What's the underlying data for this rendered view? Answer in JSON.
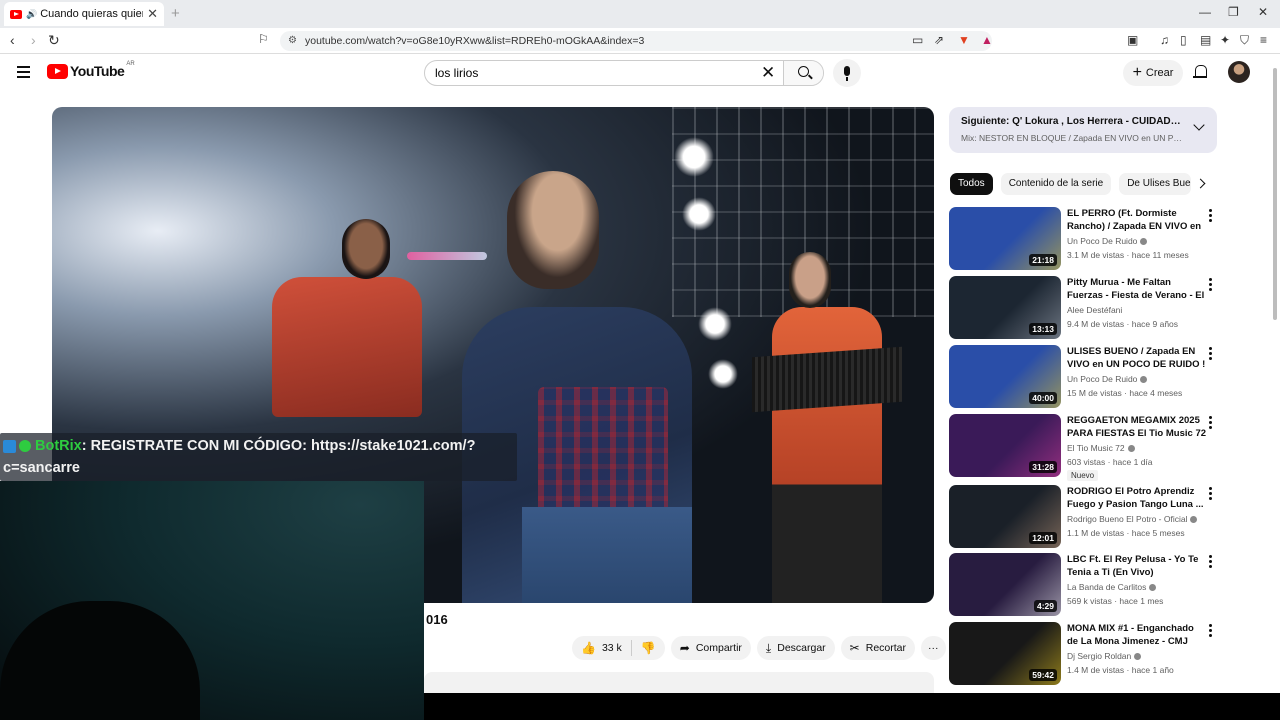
{
  "browser": {
    "tab_title": "Cuando quieras quiero/Ojalá",
    "tab_close": "✕",
    "new_tab": "+",
    "url": "youtube.com/watch?v=oG8e10yRXww&list=RDREh0-mOGkAA&index=3",
    "window_controls": [
      "—",
      "❐",
      "✕"
    ],
    "nav": [
      "‹",
      "›",
      "↻"
    ]
  },
  "header": {
    "logo_text": "YouTube",
    "country_code": "AR",
    "search_value": "los lirios",
    "create_label": "Crear"
  },
  "overlay": {
    "bot_name": "BotRix",
    "chat_line1": " : REGISTRATE CON MI CÓDIGO: https://stake1021.com/?",
    "chat_line2": "c=sancarre"
  },
  "video": {
    "title_fragment": "016",
    "like_count": "33 k",
    "share_label": "Compartir",
    "download_label": "Descargar",
    "clip_label": "Recortar",
    "more_label": "···"
  },
  "up_next": {
    "title": "Siguiente: Q' Lokura , Los Herrera - CUIDADO QUE T...",
    "mix": "Mix: NESTOR EN BLOQUE / Zapada EN VIVO en UN POCO D..."
  },
  "chips": [
    "Todos",
    "Contenido de la serie",
    "De Ulises Bueno"
  ],
  "recommendations": [
    {
      "title": "EL PERRO (Ft. Dormiste Rancho) / Zapada EN VIVO en ...",
      "channel": "Un Poco De Ruido",
      "verified": true,
      "meta": "3.1 M de vistas · hace 11 meses",
      "duration": "21:18",
      "thumb_color": "#2a4ea8",
      "accent": "#f5d21f"
    },
    {
      "title": "Pitty Murua - Me Faltan Fuerzas - Fiesta de Verano - El ...",
      "channel": "Alee Destéfani",
      "verified": false,
      "meta": "9.4 M de vistas · hace 9 años",
      "duration": "13:13",
      "thumb_color": "#1c2632",
      "accent": "#b0b8c4"
    },
    {
      "title": "ULISES BUENO / Zapada EN VIVO en UN POCO DE RUIDO !",
      "channel": "Un Poco De Ruido",
      "verified": true,
      "meta": "15 M de vistas · hace 4 meses",
      "duration": "40:00",
      "thumb_color": "#2a4ea8",
      "accent": "#f5d21f"
    },
    {
      "title": "REGGAETON MEGAMIX 2025 PARA FIESTAS El Tio Music 72",
      "channel": "El Tio Music 72",
      "verified": true,
      "meta": "603 vistas · hace 1 día",
      "duration": "31:28",
      "thumb_color": "#3a1a58",
      "accent": "#e040a0",
      "new_label": "Nuevo"
    },
    {
      "title": "RODRIGO El Potro Aprendiz Fuego y Pasion Tango Luna ...",
      "channel": "Rodrigo Bueno El Potro - Oficial",
      "verified": true,
      "meta": "1.1 M de vistas · hace 5 meses",
      "duration": "12:01",
      "thumb_color": "#1a2028",
      "accent": "#c8a080"
    },
    {
      "title": "LBC Ft. El Rey Pelusa - Yo Te Tenia a Ti (En Vivo)",
      "channel": "La Banda de Carlitos",
      "verified": true,
      "meta": "569 k vistas · hace 1 mes",
      "duration": "4:29",
      "thumb_color": "#281c40",
      "accent": "#ffffff"
    },
    {
      "title": "MONA MIX #1 - Enganchado de La Mona Jimenez - CMJ",
      "channel": "Dj Sergio Roldan",
      "verified": true,
      "meta": "1.4 M de vistas · hace 1 año",
      "duration": "59:42",
      "thumb_color": "#181818",
      "accent": "#f5d21f"
    }
  ],
  "colors": {
    "brand_red": "#ff0000",
    "bot_green": "#2ecc40"
  }
}
